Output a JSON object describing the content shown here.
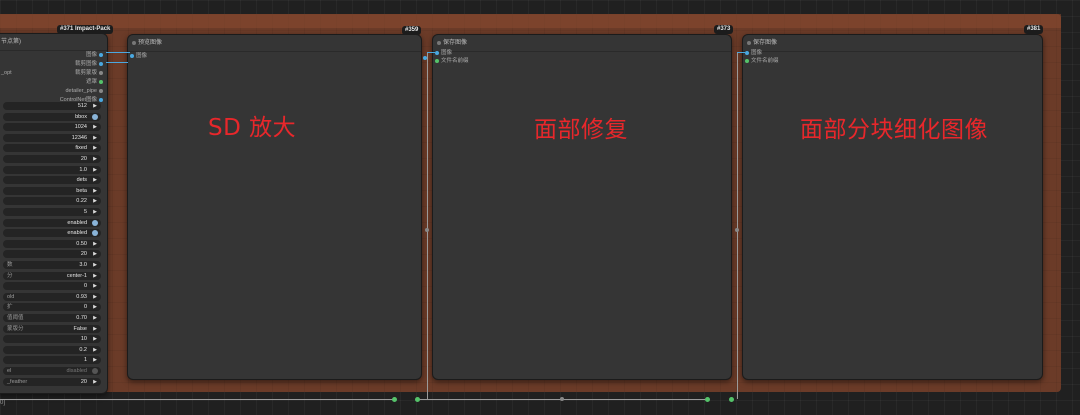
{
  "nodes": {
    "impact_pack": {
      "badge": "#371 Impact-Pack",
      "title_fragment": "节点第)",
      "outputs": [
        "图像",
        "裁剪图像",
        "裁剪蒙版",
        "遮罩",
        "detailer_pipe",
        "ControlNet图像"
      ],
      "partial_input": "_opt",
      "widgets": [
        {
          "label": "",
          "value": "512",
          "kind": "arrow"
        },
        {
          "label": "",
          "value": "bbox",
          "kind": "toggle"
        },
        {
          "label": "",
          "value": "1024",
          "kind": "arrow"
        },
        {
          "label": "",
          "value": "12346",
          "kind": "arrow"
        },
        {
          "label": "",
          "value": "fixed",
          "kind": "arrow"
        },
        {
          "label": "",
          "value": "20",
          "kind": "arrow"
        },
        {
          "label": "",
          "value": "1.0",
          "kind": "arrow"
        },
        {
          "label": "",
          "value": "dets",
          "kind": "arrow"
        },
        {
          "label": "",
          "value": "beta",
          "kind": "arrow"
        },
        {
          "label": "",
          "value": "0.22",
          "kind": "arrow"
        },
        {
          "label": "",
          "value": "5",
          "kind": "arrow"
        },
        {
          "label": "",
          "value": "enabled",
          "kind": "toggle"
        },
        {
          "label": "",
          "value": "enabled",
          "kind": "toggle"
        },
        {
          "label": "",
          "value": "0.50",
          "kind": "arrow"
        },
        {
          "label": "",
          "value": "20",
          "kind": "arrow"
        },
        {
          "label": "数",
          "value": "3.0",
          "kind": "arrow"
        },
        {
          "label": "分",
          "value": "center-1",
          "kind": "arrow"
        },
        {
          "label": "",
          "value": "0",
          "kind": "arrow"
        },
        {
          "label": "old",
          "value": "0.93",
          "kind": "arrow"
        },
        {
          "label": "扩",
          "value": "0",
          "kind": "arrow"
        },
        {
          "label": "值阈值",
          "value": "0.70",
          "kind": "arrow"
        },
        {
          "label": "蒙版分",
          "value": "False",
          "kind": "arrow"
        },
        {
          "label": "",
          "value": "10",
          "kind": "arrow"
        },
        {
          "label": "",
          "value": "0.2",
          "kind": "arrow"
        },
        {
          "label": "",
          "value": "1",
          "kind": "arrow"
        },
        {
          "label": "el",
          "value": "disabled",
          "kind": "toggle-off"
        },
        {
          "label": "_feather",
          "value": "20",
          "kind": "arrow"
        }
      ]
    },
    "n359": {
      "badge": "#359",
      "title": "预览图像",
      "inputs": [
        "图像"
      ]
    },
    "n373": {
      "badge": "#373",
      "title": "保存图像",
      "inputs": [
        "图像",
        "文件名前缀"
      ]
    },
    "n381": {
      "badge": "#381",
      "title": "保存图像",
      "inputs": [
        "图像",
        "文件名前缀"
      ]
    }
  },
  "labels": {
    "sd_upscale": "SD 放大",
    "face_fix": "面部修复",
    "face_tile": "面部分块细化图像"
  },
  "bottom_text": "0]",
  "colors": {
    "group_bg": "#6b3b28",
    "label_red": "#e8272b",
    "image_pin": "#4aa8e0",
    "string_pin": "#55c36a"
  }
}
